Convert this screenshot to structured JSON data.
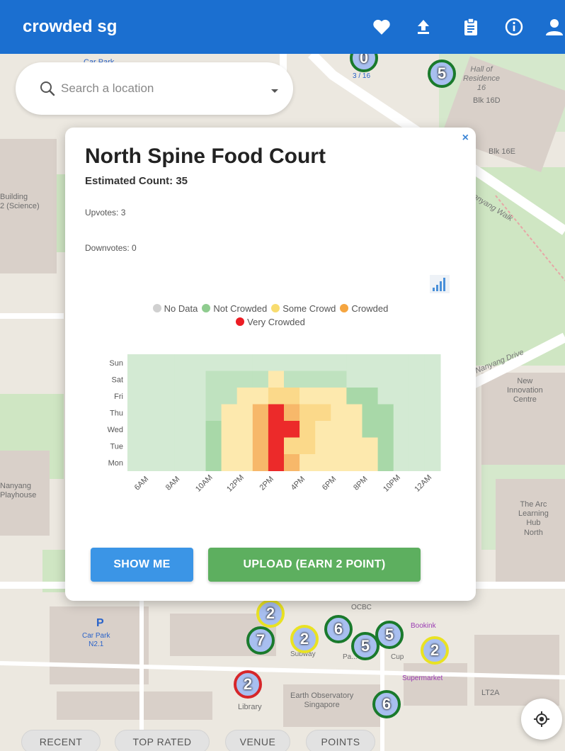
{
  "app": {
    "title": "crowded sg"
  },
  "toolbar": {
    "icons": [
      "heart-icon",
      "upload-icon",
      "clipboard-icon",
      "info-icon",
      "user-icon"
    ]
  },
  "search": {
    "placeholder": "Search a location"
  },
  "map": {
    "labels": {
      "car_park_top": "Car Park",
      "hall_of_residence": "Hall of\nResidence\n16",
      "blk_16d": "Blk 16D",
      "blk_16e": "Blk 16E",
      "building_science": "Building\n2 (Science)",
      "nanyang_walk": "Nanyang Walk",
      "nanyang_drive": "Nanyang Drive",
      "new_innovation_centre": "New\nInnovation\nCentre",
      "nanyang_playhouse": "Nanyang\nPlayhouse",
      "arc": "The Arc\nLearning\nHub\nNorth",
      "car_park_n21_p": "P",
      "car_park_n21": "Car Park\nN2.1",
      "ocbc": "OCBC",
      "subway": "Subway",
      "popular": "Pa...",
      "cup": "Cup",
      "bookink": "Bookink",
      "supermarket": "Supermarket",
      "lt2a": "LT2A",
      "library": "Library",
      "earth_observatory": "Earth Observatory\nSingapore",
      "top_marker_sub": "3 / 16"
    },
    "clusters": [
      {
        "n": "5",
        "ring": "green"
      },
      {
        "n": "0",
        "ring": "green"
      },
      {
        "n": "2",
        "ring": "yellow"
      },
      {
        "n": "7",
        "ring": "green"
      },
      {
        "n": "2",
        "ring": "yellow"
      },
      {
        "n": "6",
        "ring": "green"
      },
      {
        "n": "5",
        "ring": "green"
      },
      {
        "n": "5",
        "ring": "green"
      },
      {
        "n": "2",
        "ring": "yellow"
      },
      {
        "n": "2",
        "ring": "red"
      },
      {
        "n": "6",
        "ring": "green"
      }
    ]
  },
  "popup": {
    "close": "×",
    "title": "North Spine Food Court",
    "estimated": "Estimated Count: 35",
    "upvotes": "Upvotes: 3",
    "downvotes": "Downvotes: 0",
    "legend": [
      {
        "label": "No Data",
        "color": "#d0d0d0"
      },
      {
        "label": "Not Crowded",
        "color": "#8fcc8f"
      },
      {
        "label": "Some Crowd",
        "color": "#f8dc6f"
      },
      {
        "label": "Crowded",
        "color": "#f5a540"
      },
      {
        "label": "Very Crowded",
        "color": "#ec1c24"
      }
    ],
    "show_me": "SHOW ME",
    "upload": "UPLOAD (EARN 2 POINT)"
  },
  "chart_data": {
    "type": "heatmap",
    "days": [
      "Sun",
      "Sat",
      "Fri",
      "Thu",
      "Wed",
      "Tue",
      "Mon"
    ],
    "hour_ticks": [
      "6AM",
      "8AM",
      "10AM",
      "12PM",
      "2PM",
      "4PM",
      "6PM",
      "8PM",
      "10PM",
      "12AM"
    ],
    "hours": [
      5,
      6,
      7,
      8,
      9,
      10,
      11,
      12,
      13,
      14,
      15,
      16,
      17,
      18,
      19,
      20,
      21,
      22,
      23,
      0
    ],
    "palette": {
      "0": "#d3ead3",
      "1": "#bfe2bf",
      "2": "#a8d8a8",
      "3": "#fde9ae",
      "4": "#fbd98a",
      "5": "#f7b86a",
      "6": "#ec2a2a"
    },
    "rows": {
      "Sun": [
        0,
        0,
        0,
        0,
        0,
        0,
        0,
        0,
        0,
        0,
        0,
        0,
        0,
        0,
        0,
        0,
        0,
        0,
        0,
        0
      ],
      "Sat": [
        0,
        0,
        0,
        0,
        0,
        1,
        1,
        1,
        1,
        3,
        1,
        1,
        1,
        1,
        0,
        0,
        0,
        0,
        0,
        0
      ],
      "Fri": [
        0,
        0,
        0,
        0,
        0,
        1,
        1,
        3,
        3,
        4,
        4,
        3,
        3,
        3,
        2,
        2,
        0,
        0,
        0,
        0
      ],
      "Thu": [
        0,
        0,
        0,
        0,
        0,
        1,
        3,
        3,
        5,
        6,
        5,
        4,
        4,
        3,
        3,
        2,
        2,
        0,
        0,
        0
      ],
      "Wed": [
        0,
        0,
        0,
        0,
        0,
        2,
        3,
        3,
        5,
        6,
        6,
        4,
        3,
        3,
        3,
        2,
        2,
        0,
        0,
        0
      ],
      "Tue": [
        0,
        0,
        0,
        0,
        0,
        2,
        3,
        3,
        5,
        6,
        4,
        4,
        3,
        3,
        3,
        3,
        2,
        0,
        0,
        0
      ],
      "Mon": [
        0,
        0,
        0,
        0,
        0,
        2,
        3,
        3,
        5,
        6,
        5,
        3,
        3,
        3,
        3,
        3,
        2,
        0,
        0,
        0
      ]
    }
  },
  "chips": [
    "RECENT",
    "TOP RATED",
    "VENUE",
    "POINTS"
  ]
}
